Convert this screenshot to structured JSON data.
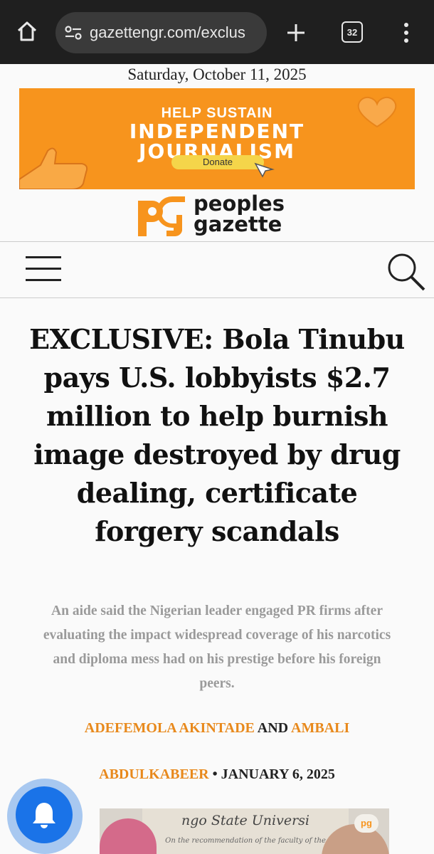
{
  "browser": {
    "url": "gazettengr.com/exclus",
    "tab_count": "32"
  },
  "page": {
    "date": "Saturday, October 11, 2025",
    "banner": {
      "line1": "HELP SUSTAIN",
      "line2": "INDEPENDENT",
      "line3": "JOURNALISM",
      "donate_label": "Donate"
    },
    "logo": {
      "mark": "pg",
      "line1": "peoples",
      "line2": "gazette"
    },
    "article": {
      "headline": "EXCLUSIVE: Bola Tinubu pays U.S. lobbyists $2.7 million to help burnish image destroyed by drug dealing, certificate forgery scandals",
      "dek": "An aide said the Nigerian leader engaged PR firms after evaluating the impact widespread coverage of his narcotics and diploma mess had on his prestige before his foreign peers.",
      "author1": "ADEFEMOLA AKINTADE",
      "and": "AND",
      "author2": "AMBALI",
      "author2_cont": "ABDULKABEER",
      "separator": "•",
      "date": "JANUARY 6, 2025"
    },
    "hero": {
      "cert_title": "ngo State Universi",
      "cert_sub": "On the recommendation of the faculty of the",
      "badge": "pg"
    }
  },
  "colors": {
    "accent": "#f7941d",
    "author": "#e8891c",
    "notification": "#1a73e8"
  }
}
